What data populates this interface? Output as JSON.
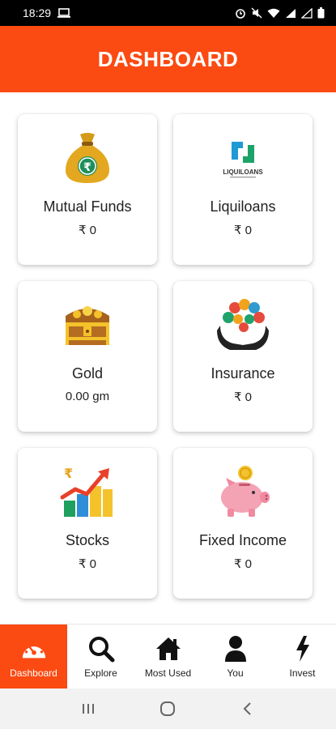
{
  "status_bar": {
    "time": "18:29",
    "icons": [
      "laptop-icon",
      "alarm-icon",
      "mute-icon",
      "wifi-icon",
      "lte-signal-icon",
      "signal-icon",
      "battery-icon"
    ]
  },
  "header": {
    "title": "DASHBOARD"
  },
  "cards": [
    {
      "label": "Mutual Funds",
      "value": "₹ 0",
      "icon": "money-bag-icon"
    },
    {
      "label": "Liquiloans",
      "value": "₹ 0",
      "icon": "liquiloans-logo",
      "logo_text": "LIQUILOANS"
    },
    {
      "label": "Gold",
      "value": "0.00 gm",
      "icon": "treasure-chest-icon"
    },
    {
      "label": "Insurance",
      "value": "₹ 0",
      "icon": "insurance-hands-icon"
    },
    {
      "label": "Stocks",
      "value": "₹ 0",
      "icon": "stocks-chart-icon"
    },
    {
      "label": "Fixed Income",
      "value": "₹ 0",
      "icon": "piggy-bank-icon"
    }
  ],
  "bottom_nav": [
    {
      "label": "Dashboard",
      "icon": "speedometer-icon",
      "active": true
    },
    {
      "label": "Explore",
      "icon": "search-icon",
      "active": false
    },
    {
      "label": "Most Used",
      "icon": "home-icon",
      "active": false
    },
    {
      "label": "You",
      "icon": "person-icon",
      "active": false
    },
    {
      "label": "Invest",
      "icon": "lightning-icon",
      "active": false
    }
  ],
  "colors": {
    "accent": "#fb4a12",
    "text": "#222222",
    "background": "#ffffff"
  }
}
